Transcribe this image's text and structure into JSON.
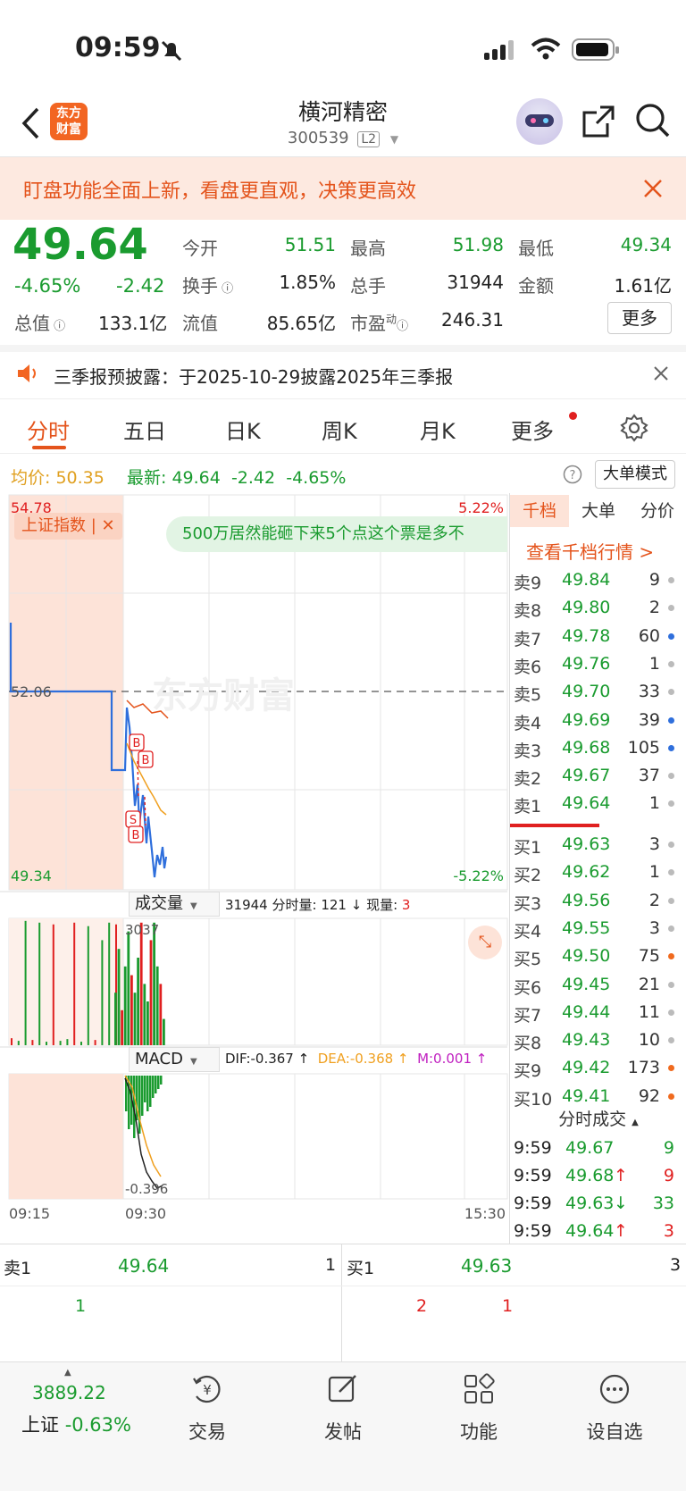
{
  "status": {
    "time": "09:59"
  },
  "nav": {
    "title": "横河精密",
    "code": "300539",
    "level": "L2",
    "logo_line1": "东方",
    "logo_line2": "财富"
  },
  "banner": {
    "text": "盯盘功能全面上新，看盘更直观，决策更高效"
  },
  "quote": {
    "price": "49.64",
    "pct": "-4.65%",
    "change": "-2.42",
    "open_label": "今开",
    "open": "51.51",
    "high_label": "最高",
    "high": "51.98",
    "low_label": "最低",
    "low": "49.34",
    "turnover_label": "换手",
    "turnover": "1.85%",
    "volume_label": "总手",
    "volume": "31944",
    "amount_label": "金额",
    "amount": "1.61亿",
    "mktcap_label": "总值",
    "mktcap": "133.1亿",
    "float_label": "流值",
    "float": "85.65亿",
    "pe_label": "市盈",
    "pe_sup": "动",
    "pe": "246.31",
    "more": "更多"
  },
  "notice": {
    "text": "三季报预披露：于2025-10-29披露2025年三季报"
  },
  "tabs": {
    "items": [
      "分时",
      "五日",
      "日K",
      "周K",
      "月K",
      "更多"
    ]
  },
  "avgrow": {
    "avg_label": "均价:",
    "avg": "50.35",
    "last_label": "最新:",
    "last": "49.64",
    "chg": "-2.42",
    "pct": "-4.65%",
    "mode": "大单模式"
  },
  "chart": {
    "y_top": "54.78",
    "y_top_pct": "5.22%",
    "y_mid": "52.06",
    "y_bot": "49.34",
    "y_bot_pct": "-5.22%",
    "index_tag": "上证指数",
    "comment": "500万居然能砸下来5个点这个票是多不",
    "watermark": "东方财富",
    "vol_label": "成交量",
    "vol_total": "31944",
    "vol_seg": "分时量: 121",
    "vol_now_label": "现量:",
    "vol_now": "3",
    "vol_max": "3037",
    "macd_label": "MACD",
    "dif": "DIF:-0.367 ↑",
    "dea": "DEA:-0.368 ↑",
    "m": "M:0.001 ↑",
    "macd_min": "-0.396",
    "t_start": "09:15",
    "t_mid": "09:30",
    "t_end": "15:30",
    "marker_b": "B",
    "marker_s": "S"
  },
  "book": {
    "tabs": [
      "千档",
      "大单",
      "分价"
    ],
    "link": "查看千档行情 >",
    "asks": [
      {
        "label": "卖9",
        "price": "49.84",
        "vol": "9",
        "dot": "#bbbbbb"
      },
      {
        "label": "卖8",
        "price": "49.80",
        "vol": "2",
        "dot": "#bbbbbb"
      },
      {
        "label": "卖7",
        "price": "49.78",
        "vol": "60",
        "dot": "#2f6fdc"
      },
      {
        "label": "卖6",
        "price": "49.76",
        "vol": "1",
        "dot": "#bbbbbb"
      },
      {
        "label": "卖5",
        "price": "49.70",
        "vol": "33",
        "dot": "#bbbbbb"
      },
      {
        "label": "卖4",
        "price": "49.69",
        "vol": "39",
        "dot": "#2f6fdc"
      },
      {
        "label": "卖3",
        "price": "49.68",
        "vol": "105",
        "dot": "#2f6fdc"
      },
      {
        "label": "卖2",
        "price": "49.67",
        "vol": "37",
        "dot": "#bbbbbb"
      },
      {
        "label": "卖1",
        "price": "49.64",
        "vol": "1",
        "dot": "#bbbbbb"
      }
    ],
    "bids": [
      {
        "label": "买1",
        "price": "49.63",
        "vol": "3",
        "dot": "#bbbbbb"
      },
      {
        "label": "买2",
        "price": "49.62",
        "vol": "1",
        "dot": "#bbbbbb"
      },
      {
        "label": "买3",
        "price": "49.56",
        "vol": "2",
        "dot": "#bbbbbb"
      },
      {
        "label": "买4",
        "price": "49.55",
        "vol": "3",
        "dot": "#bbbbbb"
      },
      {
        "label": "买5",
        "price": "49.50",
        "vol": "75",
        "dot": "#f06a1e"
      },
      {
        "label": "买6",
        "price": "49.45",
        "vol": "21",
        "dot": "#bbbbbb"
      },
      {
        "label": "买7",
        "price": "49.44",
        "vol": "11",
        "dot": "#bbbbbb"
      },
      {
        "label": "买8",
        "price": "49.43",
        "vol": "10",
        "dot": "#bbbbbb"
      },
      {
        "label": "买9",
        "price": "49.42",
        "vol": "173",
        "dot": "#f06a1e"
      },
      {
        "label": "买10",
        "price": "49.41",
        "vol": "92",
        "dot": "#f06a1e"
      }
    ],
    "ticks_title": "分时成交",
    "ticks": [
      {
        "time": "9:59",
        "price": "49.67",
        "dir": "",
        "vol": "9"
      },
      {
        "time": "9:59",
        "price": "49.68",
        "dir": "↑",
        "vol": "9"
      },
      {
        "time": "9:59",
        "price": "49.63",
        "dir": "↓",
        "vol": "33"
      },
      {
        "time": "9:59",
        "price": "49.64",
        "dir": "↑",
        "vol": "3"
      }
    ]
  },
  "bottom": {
    "ask_label": "卖1",
    "ask_price": "49.64",
    "ask_vol": "1",
    "bid_label": "买1",
    "bid_price": "49.63",
    "bid_vol": "3",
    "ask_q1": "1",
    "bid_q1": "2",
    "bid_q2": "1"
  },
  "tabbar": {
    "index_value": "3889.22",
    "index_name": "上证",
    "index_pct": "-0.63%",
    "items": [
      "交易",
      "发帖",
      "功能",
      "设自选"
    ]
  }
}
